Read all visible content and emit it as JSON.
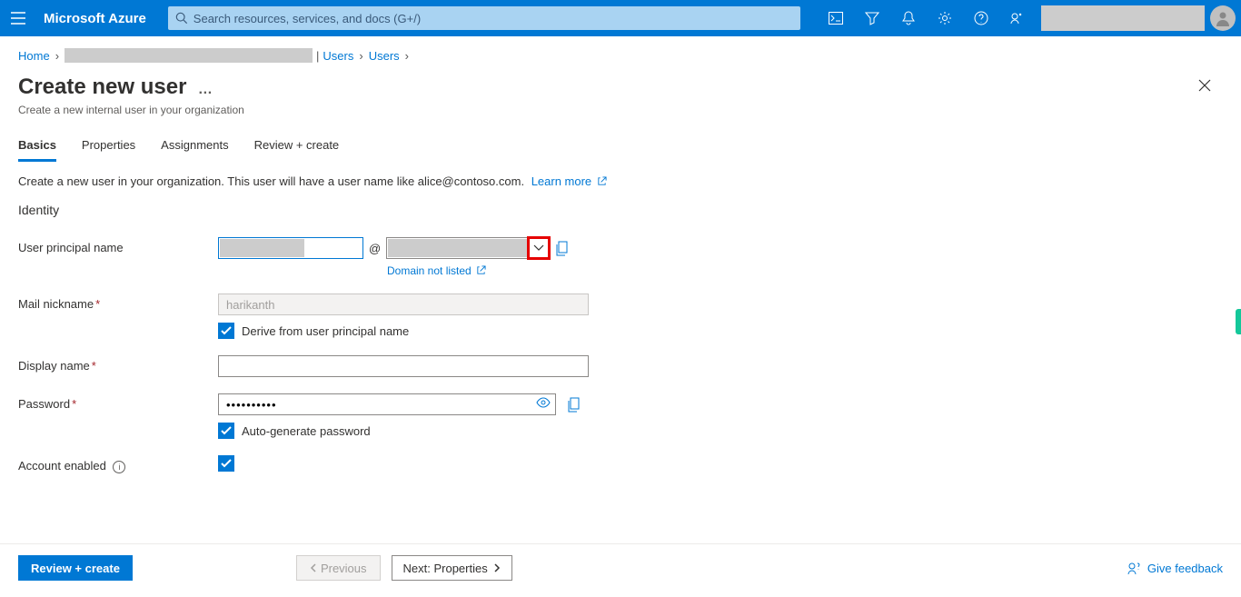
{
  "brand": "Microsoft Azure",
  "search": {
    "placeholder": "Search resources, services, and docs (G+/)"
  },
  "breadcrumb": {
    "home": "Home",
    "users1": "Users",
    "users2": "Users"
  },
  "page": {
    "title": "Create new user",
    "subtitle": "Create a new internal user in your organization",
    "more": "…"
  },
  "tabs": {
    "basics": "Basics",
    "properties": "Properties",
    "assignments": "Assignments",
    "review": "Review + create"
  },
  "desc": {
    "text": "Create a new user in your organization. This user will have a user name like alice@contoso.com.",
    "learn_more": "Learn more"
  },
  "section": {
    "identity": "Identity"
  },
  "fields": {
    "upn_label": "User principal name",
    "at": "@",
    "domain_not_listed": "Domain not listed",
    "mail_nickname_label": "Mail nickname",
    "mail_nickname_value": "harikanth",
    "derive_label": "Derive from user principal name",
    "display_name_label": "Display name",
    "display_name_value": "",
    "password_label": "Password",
    "password_value": "••••••••••",
    "autogen_label": "Auto-generate password",
    "account_enabled_label": "Account enabled"
  },
  "footer": {
    "review": "Review + create",
    "previous": "Previous",
    "next": "Next: Properties",
    "feedback": "Give feedback"
  }
}
